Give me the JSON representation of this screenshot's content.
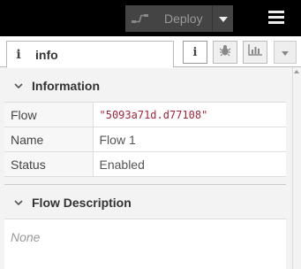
{
  "header": {
    "deploy_label": "Deploy",
    "deploy_icon": "deploy-flows-icon",
    "caret_icon": "caret-down-icon",
    "menu_icon": "hamburger-menu-icon"
  },
  "sidebar": {
    "active_tab": {
      "icon_glyph": "i",
      "label": "info"
    },
    "tab_buttons": [
      {
        "name": "info-icon",
        "glyph": "i",
        "active": true
      },
      {
        "name": "bug-icon",
        "active": false
      },
      {
        "name": "chart-icon",
        "active": false
      }
    ],
    "dropdown_icon": "caret-down-icon"
  },
  "information": {
    "title": "Information",
    "rows": [
      {
        "key": "Flow",
        "value": "\"5093a71d.d77108\""
      },
      {
        "key": "Name",
        "value": "Flow 1"
      },
      {
        "key": "Status",
        "value": "Enabled"
      }
    ]
  },
  "flow_description": {
    "title": "Flow Description",
    "placeholder": "None"
  },
  "colors": {
    "header_bg": "#000000",
    "deploy_bg": "#444444",
    "id_text": "#a1263b"
  }
}
